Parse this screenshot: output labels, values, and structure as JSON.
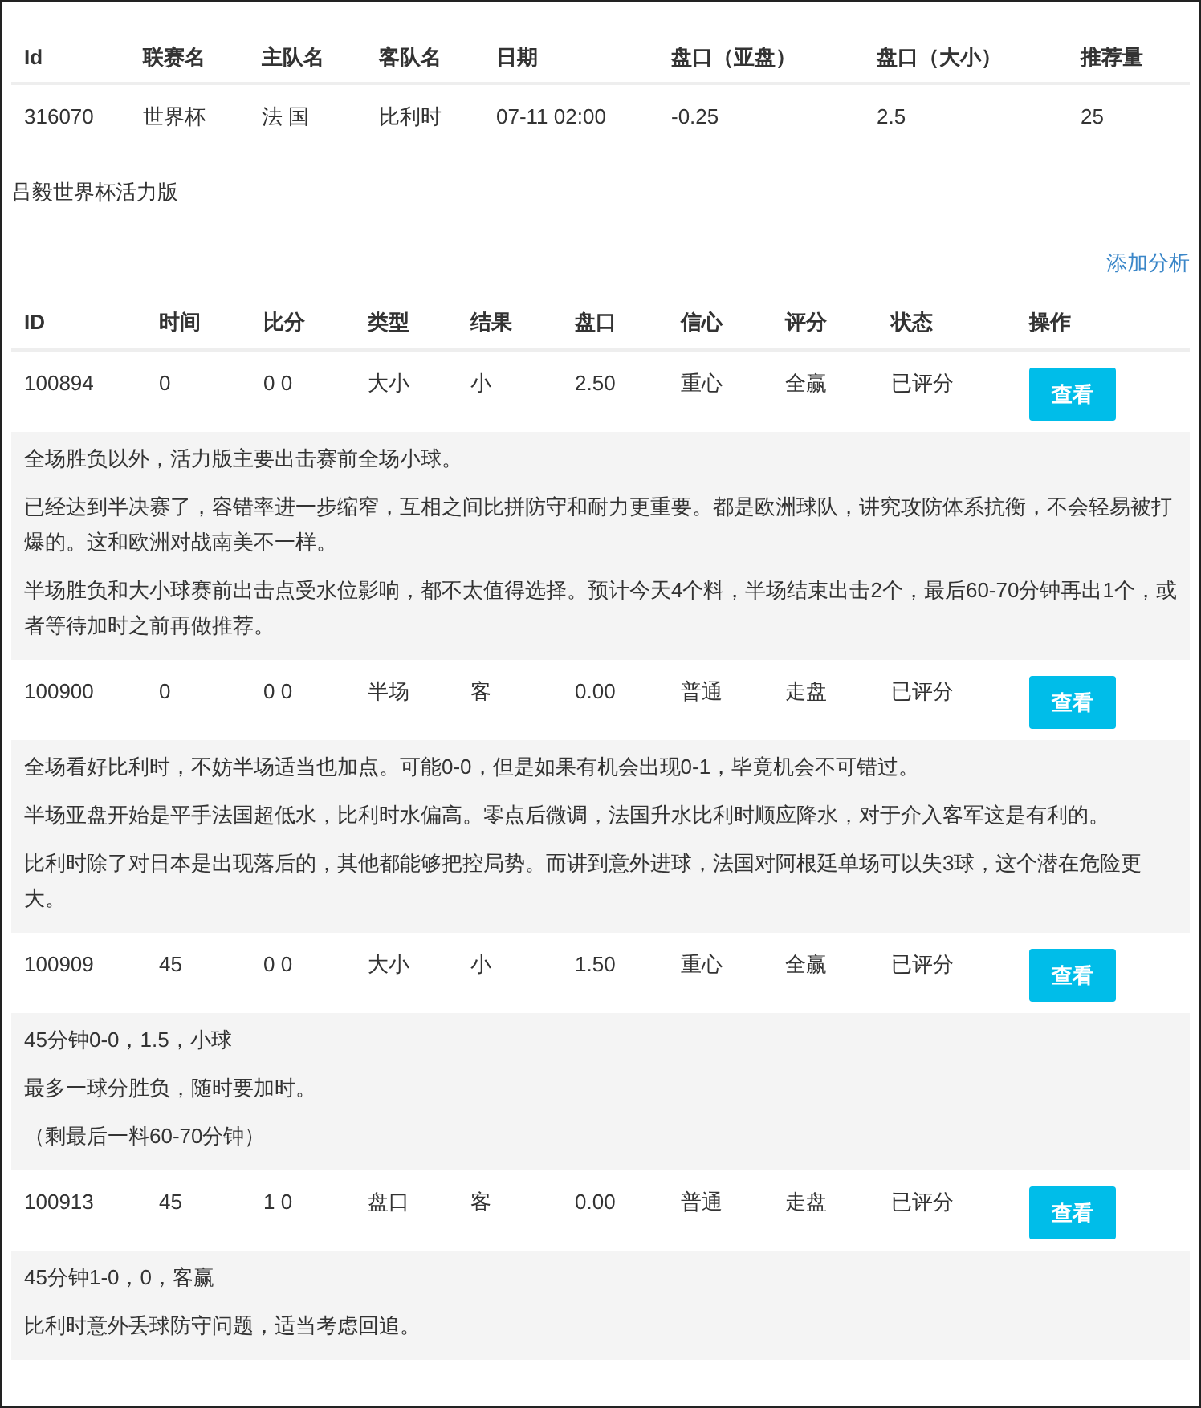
{
  "match_table": {
    "columns": [
      "Id",
      "联赛名",
      "主队名",
      "客队名",
      "日期",
      "盘口（亚盘）",
      "盘口（大小）",
      "推荐量"
    ],
    "rows": [
      [
        "316070",
        "世界杯",
        "法 国",
        "比利时",
        "07-11 02:00",
        "-0.25",
        "2.5",
        "25"
      ]
    ]
  },
  "title": "吕毅世界杯活力版",
  "add_link": "添加分析",
  "picks_table": {
    "columns": [
      "ID",
      "时间",
      "比分",
      "类型",
      "结果",
      "盘口",
      "信心",
      "评分",
      "状态",
      "操作"
    ],
    "rows": [
      {
        "cells": [
          "100894",
          "0",
          "0 0",
          "大小",
          "小",
          "2.50",
          "重心",
          "全赢",
          "已评分"
        ],
        "button": "查看",
        "notes": [
          "全场胜负以外，活力版主要出击赛前全场小球。",
          "已经达到半决赛了，容错率进一步缩窄，互相之间比拼防守和耐力更重要。都是欧洲球队，讲究攻防体系抗衡，不会轻易被打爆的。这和欧洲对战南美不一样。",
          "半场胜负和大小球赛前出击点受水位影响，都不太值得选择。预计今天4个料，半场结束出击2个，最后60-70分钟再出1个，或者等待加时之前再做推荐。"
        ]
      },
      {
        "cells": [
          "100900",
          "0",
          "0 0",
          "半场",
          "客",
          "0.00",
          "普通",
          "走盘",
          "已评分"
        ],
        "button": "查看",
        "notes": [
          "全场看好比利时，不妨半场适当也加点。可能0-0，但是如果有机会出现0-1，毕竟机会不可错过。",
          "半场亚盘开始是平手法国超低水，比利时水偏高。零点后微调，法国升水比利时顺应降水，对于介入客军这是有利的。",
          "比利时除了对日本是出现落后的，其他都能够把控局势。而讲到意外进球，法国对阿根廷单场可以失3球，这个潜在危险更大。"
        ]
      },
      {
        "cells": [
          "100909",
          "45",
          "0 0",
          "大小",
          "小",
          "1.50",
          "重心",
          "全赢",
          "已评分"
        ],
        "button": "查看",
        "notes": [
          "45分钟0-0，1.5，小球",
          "最多一球分胜负，随时要加时。",
          "（剩最后一料60-70分钟）"
        ]
      },
      {
        "cells": [
          "100913",
          "45",
          "1 0",
          "盘口",
          "客",
          "0.00",
          "普通",
          "走盘",
          "已评分"
        ],
        "button": "查看",
        "notes": [
          "45分钟1-0，0，客赢",
          "比利时意外丢球防守问题，适当考虑回追。"
        ]
      }
    ]
  }
}
